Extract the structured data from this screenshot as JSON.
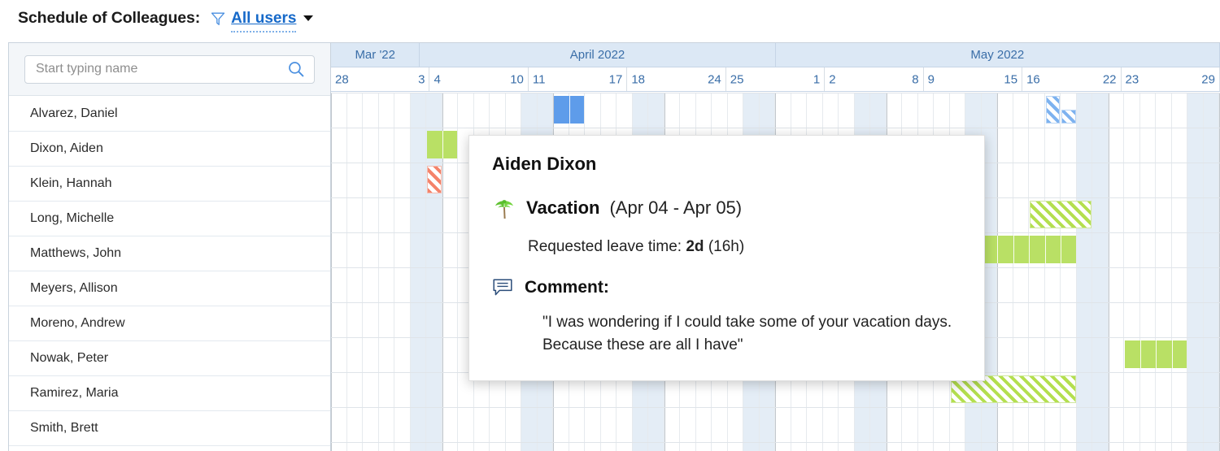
{
  "header": {
    "title": "Schedule of Colleagues:",
    "filter_label": "All users",
    "funnel_icon": "filter-funnel-icon",
    "caret_icon": "chevron-down-icon"
  },
  "search": {
    "placeholder": "Start typing name",
    "value": "",
    "icon": "search-icon"
  },
  "employees": [
    {
      "name": "Alvarez, Daniel"
    },
    {
      "name": "Dixon, Aiden"
    },
    {
      "name": "Klein, Hannah"
    },
    {
      "name": "Long, Michelle"
    },
    {
      "name": "Matthews, John"
    },
    {
      "name": "Meyers, Allison"
    },
    {
      "name": "Moreno, Andrew"
    },
    {
      "name": "Nowak, Peter"
    },
    {
      "name": "Ramirez, Maria"
    },
    {
      "name": "Smith, Brett"
    }
  ],
  "timeline": {
    "months": [
      {
        "label": "Mar '22",
        "weeks": 1
      },
      {
        "label": "April 2022",
        "weeks": 4
      },
      {
        "label": "May 2022",
        "weeks": 5
      }
    ],
    "weeks": [
      {
        "start": "28",
        "end": "3"
      },
      {
        "start": "4",
        "end": "10"
      },
      {
        "start": "11",
        "end": "17"
      },
      {
        "start": "18",
        "end": "24"
      },
      {
        "start": "25",
        "end": "1"
      },
      {
        "start": "2",
        "end": "8"
      },
      {
        "start": "9",
        "end": "15"
      },
      {
        "start": "16",
        "end": "22"
      },
      {
        "start": "23",
        "end": "29"
      }
    ],
    "day_width": 19.5,
    "total_days": 63,
    "weekend_offsets": [
      5,
      6
    ]
  },
  "colors": {
    "vacation_green": "#b9e065",
    "approved_blue": "#5e9cea",
    "rejected_red": "#f4836b",
    "header_blue": "#dce8f5",
    "weekend_shade": "#e4edf6",
    "link_blue": "#1669c9"
  },
  "bars": [
    {
      "row": 0,
      "day": 14,
      "days": 2,
      "style": "blue",
      "segments": 2,
      "label": "alvarez-approved-bar"
    },
    {
      "row": 0,
      "day": 45,
      "days": 1,
      "style": "hatch-blue",
      "half": false,
      "label": "alvarez-pending-bar"
    },
    {
      "row": 0,
      "day": 46,
      "days": 1,
      "style": "hatch-blue",
      "half": true,
      "label": "alvarez-pending-half-bar"
    },
    {
      "row": 1,
      "day": 6,
      "days": 2,
      "style": "green",
      "segments": 2,
      "label": "dixon-vacation-bar"
    },
    {
      "row": 2,
      "day": 6,
      "days": 1,
      "style": "hatch-red",
      "label": "klein-rejected-bar"
    },
    {
      "row": 3,
      "day": 44,
      "days": 4,
      "style": "hatch-green",
      "label": "long-pending-bar"
    },
    {
      "row": 4,
      "day": 41,
      "days": 6,
      "style": "green",
      "segments": 6,
      "label": "matthews-vacation-bar"
    },
    {
      "row": 7,
      "day": 50,
      "days": 4,
      "style": "green",
      "segments": 4,
      "label": "nowak-vacation-bar"
    },
    {
      "row": 8,
      "day": 39,
      "days": 8,
      "style": "hatch-green",
      "label": "ramirez-pending-bar"
    }
  ],
  "tooltip": {
    "employee": "Aiden Dixon",
    "leave_type": "Vacation",
    "date_range": "(Apr 04 - Apr 05)",
    "requested_label": "Requested leave time:",
    "requested_days": "2d",
    "requested_hours": "(16h)",
    "comment_label": "Comment:",
    "comment_text": "\"I was wondering if I could take some of your vacation days. Because these are all I have\"",
    "palm_icon": "palm-tree-icon",
    "comment_icon": "speech-bubble-icon"
  }
}
